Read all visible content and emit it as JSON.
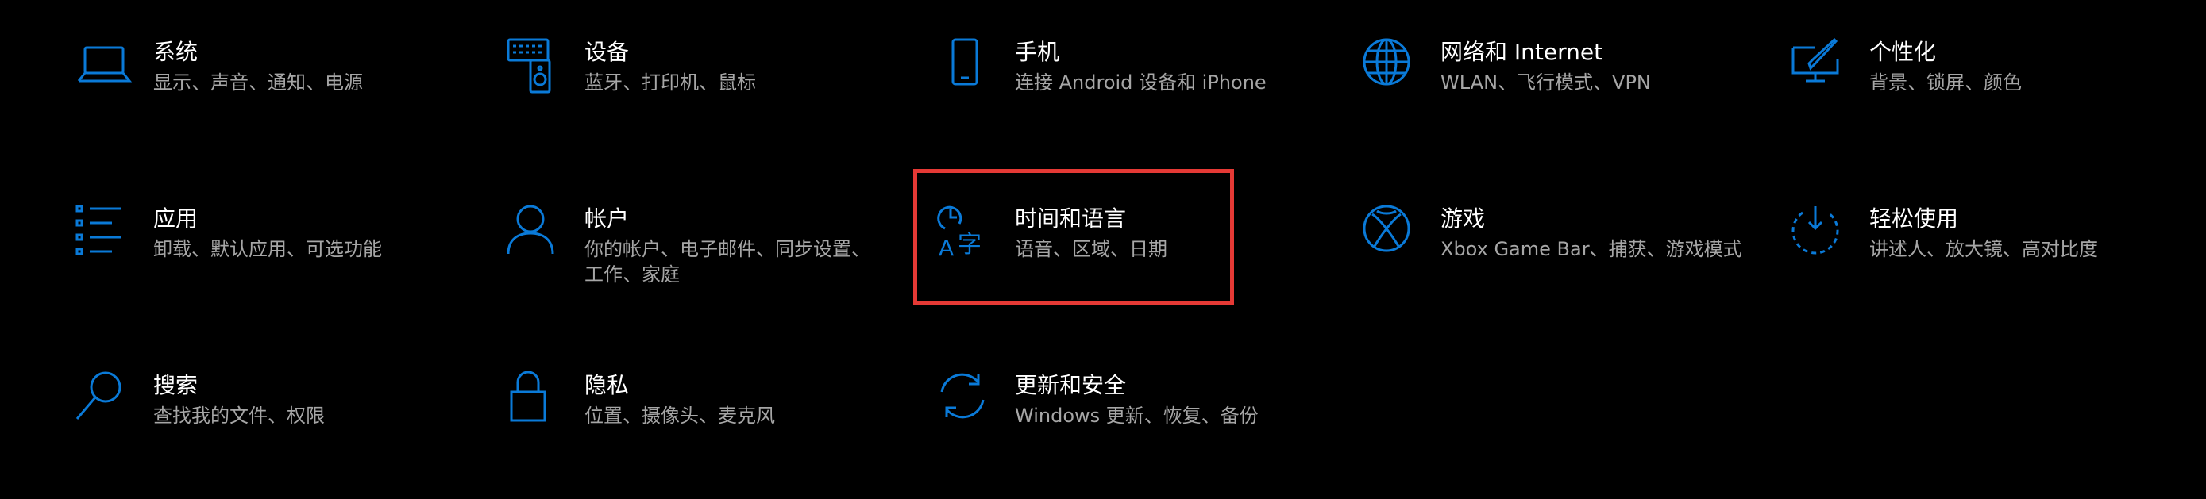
{
  "accent_color": "#0a7ad8",
  "highlight_color": "#e53935",
  "tiles": [
    {
      "id": "system",
      "icon": "laptop-icon",
      "title": "系统",
      "desc": "显示、声音、通知、电源"
    },
    {
      "id": "devices",
      "icon": "keyboard-speaker-icon",
      "title": "设备",
      "desc": "蓝牙、打印机、鼠标"
    },
    {
      "id": "phone",
      "icon": "phone-icon",
      "title": "手机",
      "desc": "连接 Android 设备和 iPhone"
    },
    {
      "id": "network",
      "icon": "globe-icon",
      "title": "网络和 Internet",
      "desc": "WLAN、飞行模式、VPN"
    },
    {
      "id": "personalization",
      "icon": "paintbrush-screen-icon",
      "title": "个性化",
      "desc": "背景、锁屏、颜色"
    },
    {
      "id": "apps",
      "icon": "apps-list-icon",
      "title": "应用",
      "desc": "卸载、默认应用、可选功能"
    },
    {
      "id": "accounts",
      "icon": "person-icon",
      "title": "帐户",
      "desc": "你的帐户、电子邮件、同步设置、工作、家庭"
    },
    {
      "id": "time-language",
      "icon": "time-language-icon",
      "title": "时间和语言",
      "desc": "语音、区域、日期"
    },
    {
      "id": "gaming",
      "icon": "xbox-icon",
      "title": "游戏",
      "desc": "Xbox Game Bar、捕获、游戏模式"
    },
    {
      "id": "ease-of-access",
      "icon": "ease-of-access-icon",
      "title": "轻松使用",
      "desc": "讲述人、放大镜、高对比度"
    },
    {
      "id": "search",
      "icon": "search-icon",
      "title": "搜索",
      "desc": "查找我的文件、权限"
    },
    {
      "id": "privacy",
      "icon": "lock-icon",
      "title": "隐私",
      "desc": "位置、摄像头、麦克风"
    },
    {
      "id": "update-security",
      "icon": "sync-arrows-icon",
      "title": "更新和安全",
      "desc": "Windows 更新、恢复、备份"
    }
  ]
}
